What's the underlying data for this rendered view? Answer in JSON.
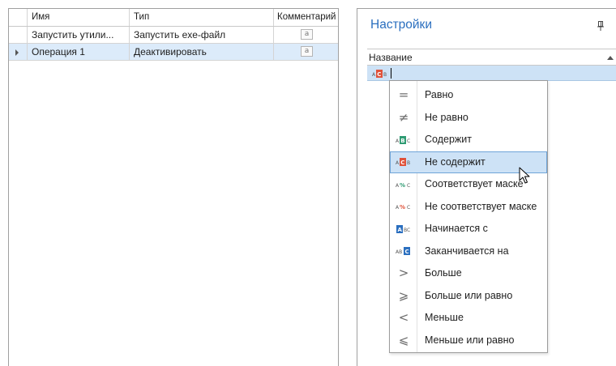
{
  "grid": {
    "columns": [
      "Имя",
      "Тип",
      "Комментарий"
    ],
    "rows": [
      {
        "name": "Запустить утили...",
        "type": "Запустить exe-файл",
        "comment_icon": "memo-icon",
        "current": false
      },
      {
        "name": "Операция 1",
        "type": "Деактивировать",
        "comment_icon": "memo-icon",
        "current": true
      }
    ],
    "memo_glyph": "a"
  },
  "panel": {
    "title": "Настройки",
    "column_header": "Название",
    "filter_operator_icon": "not-contains-icon"
  },
  "filter_menu": {
    "selected_index": 3,
    "items": [
      {
        "label": "Равно",
        "icon": "equals-icon"
      },
      {
        "label": "Не равно",
        "icon": "not-equals-icon"
      },
      {
        "label": "Содержит",
        "icon": "contains-icon"
      },
      {
        "label": "Не содержит",
        "icon": "not-contains-icon"
      },
      {
        "label": "Соответствует маске",
        "icon": "like-icon"
      },
      {
        "label": "Не соответствует маске",
        "icon": "not-like-icon"
      },
      {
        "label": "Начинается с",
        "icon": "begins-with-icon"
      },
      {
        "label": "Заканчивается на",
        "icon": "ends-with-icon"
      },
      {
        "label": "Больше",
        "icon": "greater-icon"
      },
      {
        "label": "Больше или равно",
        "icon": "greater-or-equal-icon"
      },
      {
        "label": "Меньше",
        "icon": "less-icon"
      },
      {
        "label": "Меньше или равно",
        "icon": "less-or-equal-icon"
      }
    ]
  },
  "colors": {
    "accent": "#2b6fbf",
    "selection": "#cde2f6",
    "selection_border": "#6fa4d8",
    "row_current": "#dcebfa",
    "icon_green": "#2f9b73",
    "icon_red": "#e0523a",
    "icon_blue": "#2b6fbf"
  }
}
